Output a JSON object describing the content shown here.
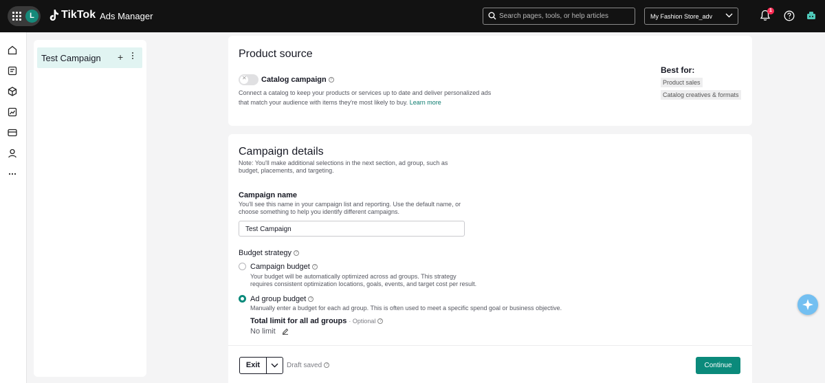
{
  "topbar": {
    "avatar_initial": "L",
    "brand_name": "TikTok",
    "product_name": "Ads Manager",
    "search_placeholder": "Search pages, tools, or help articles",
    "account_name": "My Fashion Store_adv",
    "notification_count": "1"
  },
  "sidebar": {
    "campaign_name": "Test Campaign",
    "add_symbol": "+"
  },
  "product_source": {
    "title": "Product source",
    "toggle_label": "Catalog campaign",
    "toggle_on": false,
    "description": "Connect a catalog to keep your products or services up to date and deliver personalized ads that match your audience with items they're most likely to buy.",
    "learn_more": "Learn more",
    "best_for_title": "Best for:",
    "best_for_tags": [
      "Product sales",
      "Catalog creatives & formats"
    ]
  },
  "campaign_details": {
    "title": "Campaign details",
    "note": "Note: You'll make additional selections in the next section, ad group, such as budget, placements, and targeting.",
    "name_label": "Campaign name",
    "name_help": "You'll see this name in your campaign list and reporting. Use the default name, or choose something to help you identify different campaigns.",
    "name_value": "Test Campaign",
    "budget_strategy_label": "Budget strategy",
    "options": [
      {
        "label": "Campaign budget",
        "description": "Your budget will be automatically optimized across ad groups. This strategy requires consistent optimization locations, goals, events, and target cost per result.",
        "selected": false
      },
      {
        "label": "Ad group budget",
        "description": "Manually enter a budget for each ad group. This is often used to meet a specific spend goal or business objective.",
        "selected": true
      }
    ],
    "total_limit_label": "Total limit for all ad groups",
    "optional_label": "· Optional",
    "no_limit": "No limit"
  },
  "footer": {
    "exit_label": "Exit",
    "draft_status": "Draft saved",
    "continue_label": "Continue"
  },
  "colors": {
    "accent": "#0b8a7b",
    "topbar": "#121212",
    "selected_bg": "#e1f4f2"
  }
}
